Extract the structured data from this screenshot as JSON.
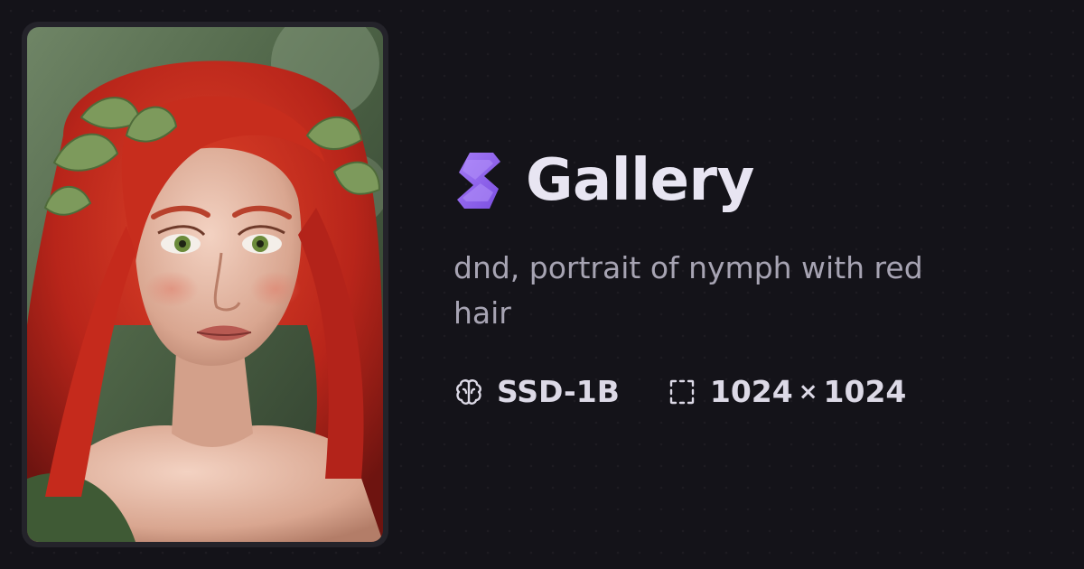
{
  "gallery": {
    "title": "Gallery",
    "logo_icon": "stability-logo-icon",
    "prompt": "dnd, portrait of nymph with red hair",
    "model": {
      "icon": "brain-icon",
      "label": "SSD-1B"
    },
    "dimensions": {
      "icon": "selection-frame-icon",
      "width": "1024",
      "separator": "×",
      "height": "1024"
    }
  },
  "colors": {
    "background": "#141319",
    "accent_purple": "#9b6bf2",
    "title_text": "#e8e5f2",
    "prompt_text": "#a7a4b3"
  }
}
